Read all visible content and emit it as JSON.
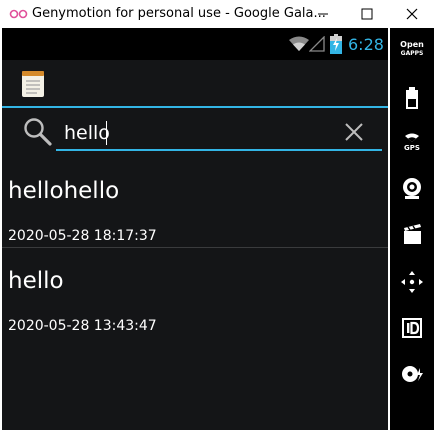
{
  "window": {
    "title": "Genymotion for personal use - Google Gala..."
  },
  "statusbar": {
    "time": "6:28"
  },
  "search": {
    "query": "hello",
    "placeholder": ""
  },
  "notes": [
    {
      "title": "hellohello",
      "date": "2020-05-28 18:17:37"
    },
    {
      "title": "hello",
      "date": "2020-05-28 13:43:47"
    }
  ],
  "sidebar": {
    "opengapps_line1": "Open",
    "opengapps_line2": "GAPPS",
    "gps_label": "GPS",
    "tools": [
      "opengapps-icon",
      "battery-icon",
      "gps-icon",
      "camera-icon",
      "media-icon",
      "dpad-icon",
      "id-icon",
      "disk-icon"
    ]
  },
  "colors": {
    "accent": "#33b5e5",
    "background": "#141517",
    "statusbar": "#000000"
  }
}
